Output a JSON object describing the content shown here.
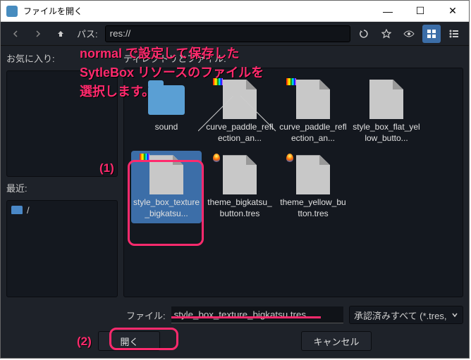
{
  "window": {
    "title": "ファイルを開く"
  },
  "toolbar": {
    "path_label": "パス:",
    "path_value": "res://"
  },
  "left": {
    "favorites_label": "お気に入り:",
    "recent_label": "最近:",
    "recent_item": "/"
  },
  "main": {
    "label": "ディレクトリとファイル:",
    "items": [
      {
        "name": "sound",
        "type": "folder"
      },
      {
        "name": "curve_paddle_reflection_an...",
        "type": "file",
        "badge": "rainbow"
      },
      {
        "name": "curve_paddle_reflection_an...",
        "type": "file",
        "badge": "rainbow"
      },
      {
        "name": "style_box_flat_yellow_butto...",
        "type": "file"
      },
      {
        "name": "style_box_texture_bigkatsu...",
        "type": "file",
        "selected": true,
        "badge": "rainbow"
      },
      {
        "name": "theme_bigkatsu_button.tres",
        "type": "file",
        "badge": "drop"
      },
      {
        "name": "theme_yellow_button.tres",
        "type": "file",
        "badge": "drop"
      }
    ]
  },
  "footer": {
    "file_label": "ファイル:",
    "file_value": "style_box_texture_bigkatsu.tres",
    "filter": "承認済みすべて (*.tres,",
    "open_label": "開く",
    "cancel_label": "キャンセル"
  },
  "annotation": {
    "text_line1": "normal で設定して保存した",
    "text_line2": "SytleBox リソースのファイルを",
    "text_line3": "選択します。",
    "marker1": "(1)",
    "marker2": "(2)"
  }
}
